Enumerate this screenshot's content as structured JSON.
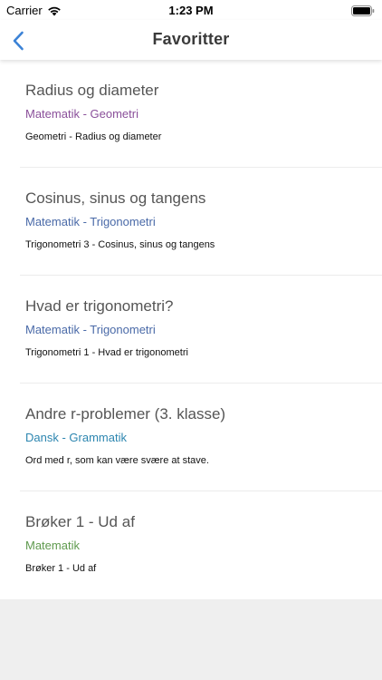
{
  "status_bar": {
    "carrier": "Carrier",
    "time": "1:23 PM",
    "wifi_icon": "wifi-icon",
    "battery_icon": "battery-icon"
  },
  "nav": {
    "title": "Favoritter",
    "back_icon": "chevron-left-icon",
    "accent_color": "#3b82d6"
  },
  "items": [
    {
      "title": "Radius og diameter",
      "subject": "Matematik - Geometri",
      "subject_color": "#8a4f9a",
      "description": "Geometri - Radius og diameter"
    },
    {
      "title": "Cosinus, sinus og tangens",
      "subject": "Matematik - Trigonometri",
      "subject_color": "#4a6aa8",
      "description": "Trigonometri 3 - Cosinus, sinus og tangens"
    },
    {
      "title": "Hvad er trigonometri?",
      "subject": "Matematik - Trigonometri",
      "subject_color": "#4a6aa8",
      "description": "Trigonometri 1 - Hvad er trigonometri"
    },
    {
      "title": "Andre r-problemer (3. klasse)",
      "subject": "Dansk - Grammatik",
      "subject_color": "#2d86b0",
      "description": "Ord med r, som kan være svære at stave."
    },
    {
      "title": "Brøker 1 - Ud af",
      "subject": "Matematik",
      "subject_color": "#5f9a4e",
      "description": "Brøker 1 - Ud af"
    }
  ]
}
